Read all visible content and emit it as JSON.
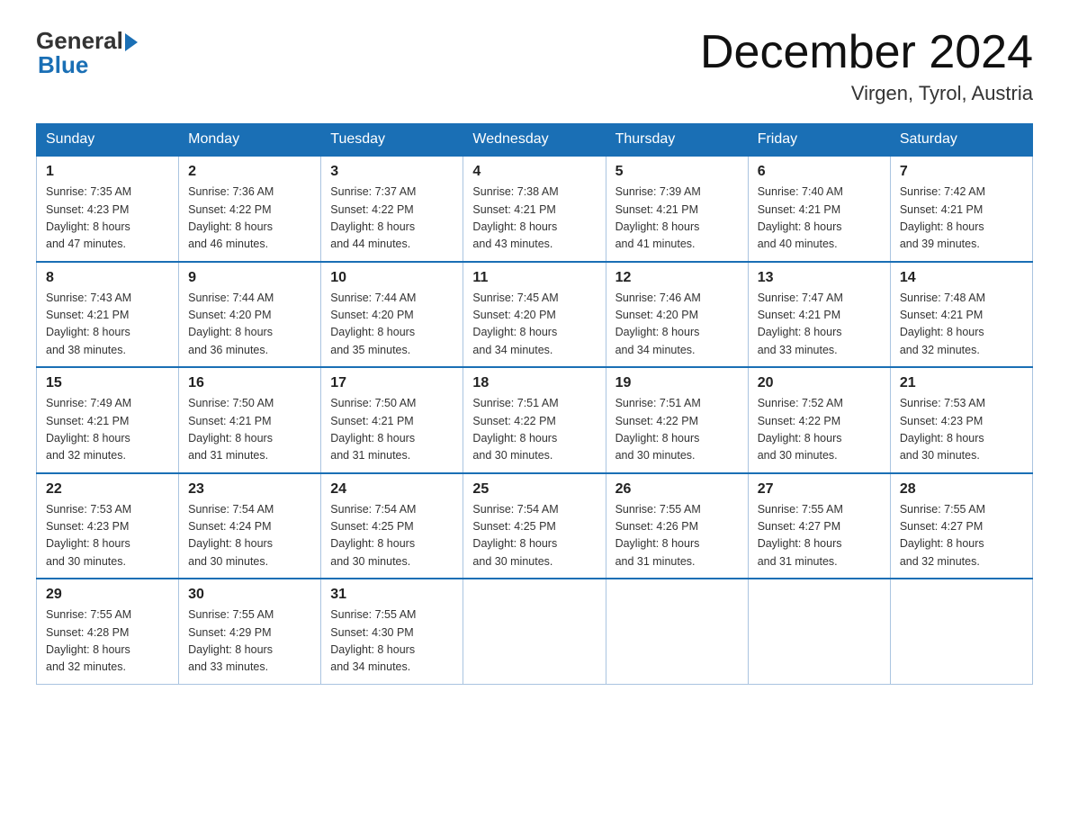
{
  "header": {
    "logo_general": "General",
    "logo_blue": "Blue",
    "month_title": "December 2024",
    "location": "Virgen, Tyrol, Austria"
  },
  "days_of_week": [
    "Sunday",
    "Monday",
    "Tuesday",
    "Wednesday",
    "Thursday",
    "Friday",
    "Saturday"
  ],
  "weeks": [
    [
      {
        "day": "1",
        "sunrise": "7:35 AM",
        "sunset": "4:23 PM",
        "daylight": "8 hours and 47 minutes."
      },
      {
        "day": "2",
        "sunrise": "7:36 AM",
        "sunset": "4:22 PM",
        "daylight": "8 hours and 46 minutes."
      },
      {
        "day": "3",
        "sunrise": "7:37 AM",
        "sunset": "4:22 PM",
        "daylight": "8 hours and 44 minutes."
      },
      {
        "day": "4",
        "sunrise": "7:38 AM",
        "sunset": "4:21 PM",
        "daylight": "8 hours and 43 minutes."
      },
      {
        "day": "5",
        "sunrise": "7:39 AM",
        "sunset": "4:21 PM",
        "daylight": "8 hours and 41 minutes."
      },
      {
        "day": "6",
        "sunrise": "7:40 AM",
        "sunset": "4:21 PM",
        "daylight": "8 hours and 40 minutes."
      },
      {
        "day": "7",
        "sunrise": "7:42 AM",
        "sunset": "4:21 PM",
        "daylight": "8 hours and 39 minutes."
      }
    ],
    [
      {
        "day": "8",
        "sunrise": "7:43 AM",
        "sunset": "4:21 PM",
        "daylight": "8 hours and 38 minutes."
      },
      {
        "day": "9",
        "sunrise": "7:44 AM",
        "sunset": "4:20 PM",
        "daylight": "8 hours and 36 minutes."
      },
      {
        "day": "10",
        "sunrise": "7:44 AM",
        "sunset": "4:20 PM",
        "daylight": "8 hours and 35 minutes."
      },
      {
        "day": "11",
        "sunrise": "7:45 AM",
        "sunset": "4:20 PM",
        "daylight": "8 hours and 34 minutes."
      },
      {
        "day": "12",
        "sunrise": "7:46 AM",
        "sunset": "4:20 PM",
        "daylight": "8 hours and 34 minutes."
      },
      {
        "day": "13",
        "sunrise": "7:47 AM",
        "sunset": "4:21 PM",
        "daylight": "8 hours and 33 minutes."
      },
      {
        "day": "14",
        "sunrise": "7:48 AM",
        "sunset": "4:21 PM",
        "daylight": "8 hours and 32 minutes."
      }
    ],
    [
      {
        "day": "15",
        "sunrise": "7:49 AM",
        "sunset": "4:21 PM",
        "daylight": "8 hours and 32 minutes."
      },
      {
        "day": "16",
        "sunrise": "7:50 AM",
        "sunset": "4:21 PM",
        "daylight": "8 hours and 31 minutes."
      },
      {
        "day": "17",
        "sunrise": "7:50 AM",
        "sunset": "4:21 PM",
        "daylight": "8 hours and 31 minutes."
      },
      {
        "day": "18",
        "sunrise": "7:51 AM",
        "sunset": "4:22 PM",
        "daylight": "8 hours and 30 minutes."
      },
      {
        "day": "19",
        "sunrise": "7:51 AM",
        "sunset": "4:22 PM",
        "daylight": "8 hours and 30 minutes."
      },
      {
        "day": "20",
        "sunrise": "7:52 AM",
        "sunset": "4:22 PM",
        "daylight": "8 hours and 30 minutes."
      },
      {
        "day": "21",
        "sunrise": "7:53 AM",
        "sunset": "4:23 PM",
        "daylight": "8 hours and 30 minutes."
      }
    ],
    [
      {
        "day": "22",
        "sunrise": "7:53 AM",
        "sunset": "4:23 PM",
        "daylight": "8 hours and 30 minutes."
      },
      {
        "day": "23",
        "sunrise": "7:54 AM",
        "sunset": "4:24 PM",
        "daylight": "8 hours and 30 minutes."
      },
      {
        "day": "24",
        "sunrise": "7:54 AM",
        "sunset": "4:25 PM",
        "daylight": "8 hours and 30 minutes."
      },
      {
        "day": "25",
        "sunrise": "7:54 AM",
        "sunset": "4:25 PM",
        "daylight": "8 hours and 30 minutes."
      },
      {
        "day": "26",
        "sunrise": "7:55 AM",
        "sunset": "4:26 PM",
        "daylight": "8 hours and 31 minutes."
      },
      {
        "day": "27",
        "sunrise": "7:55 AM",
        "sunset": "4:27 PM",
        "daylight": "8 hours and 31 minutes."
      },
      {
        "day": "28",
        "sunrise": "7:55 AM",
        "sunset": "4:27 PM",
        "daylight": "8 hours and 32 minutes."
      }
    ],
    [
      {
        "day": "29",
        "sunrise": "7:55 AM",
        "sunset": "4:28 PM",
        "daylight": "8 hours and 32 minutes."
      },
      {
        "day": "30",
        "sunrise": "7:55 AM",
        "sunset": "4:29 PM",
        "daylight": "8 hours and 33 minutes."
      },
      {
        "day": "31",
        "sunrise": "7:55 AM",
        "sunset": "4:30 PM",
        "daylight": "8 hours and 34 minutes."
      },
      null,
      null,
      null,
      null
    ]
  ],
  "labels": {
    "sunrise_prefix": "Sunrise: ",
    "sunset_prefix": "Sunset: ",
    "daylight_prefix": "Daylight: "
  }
}
